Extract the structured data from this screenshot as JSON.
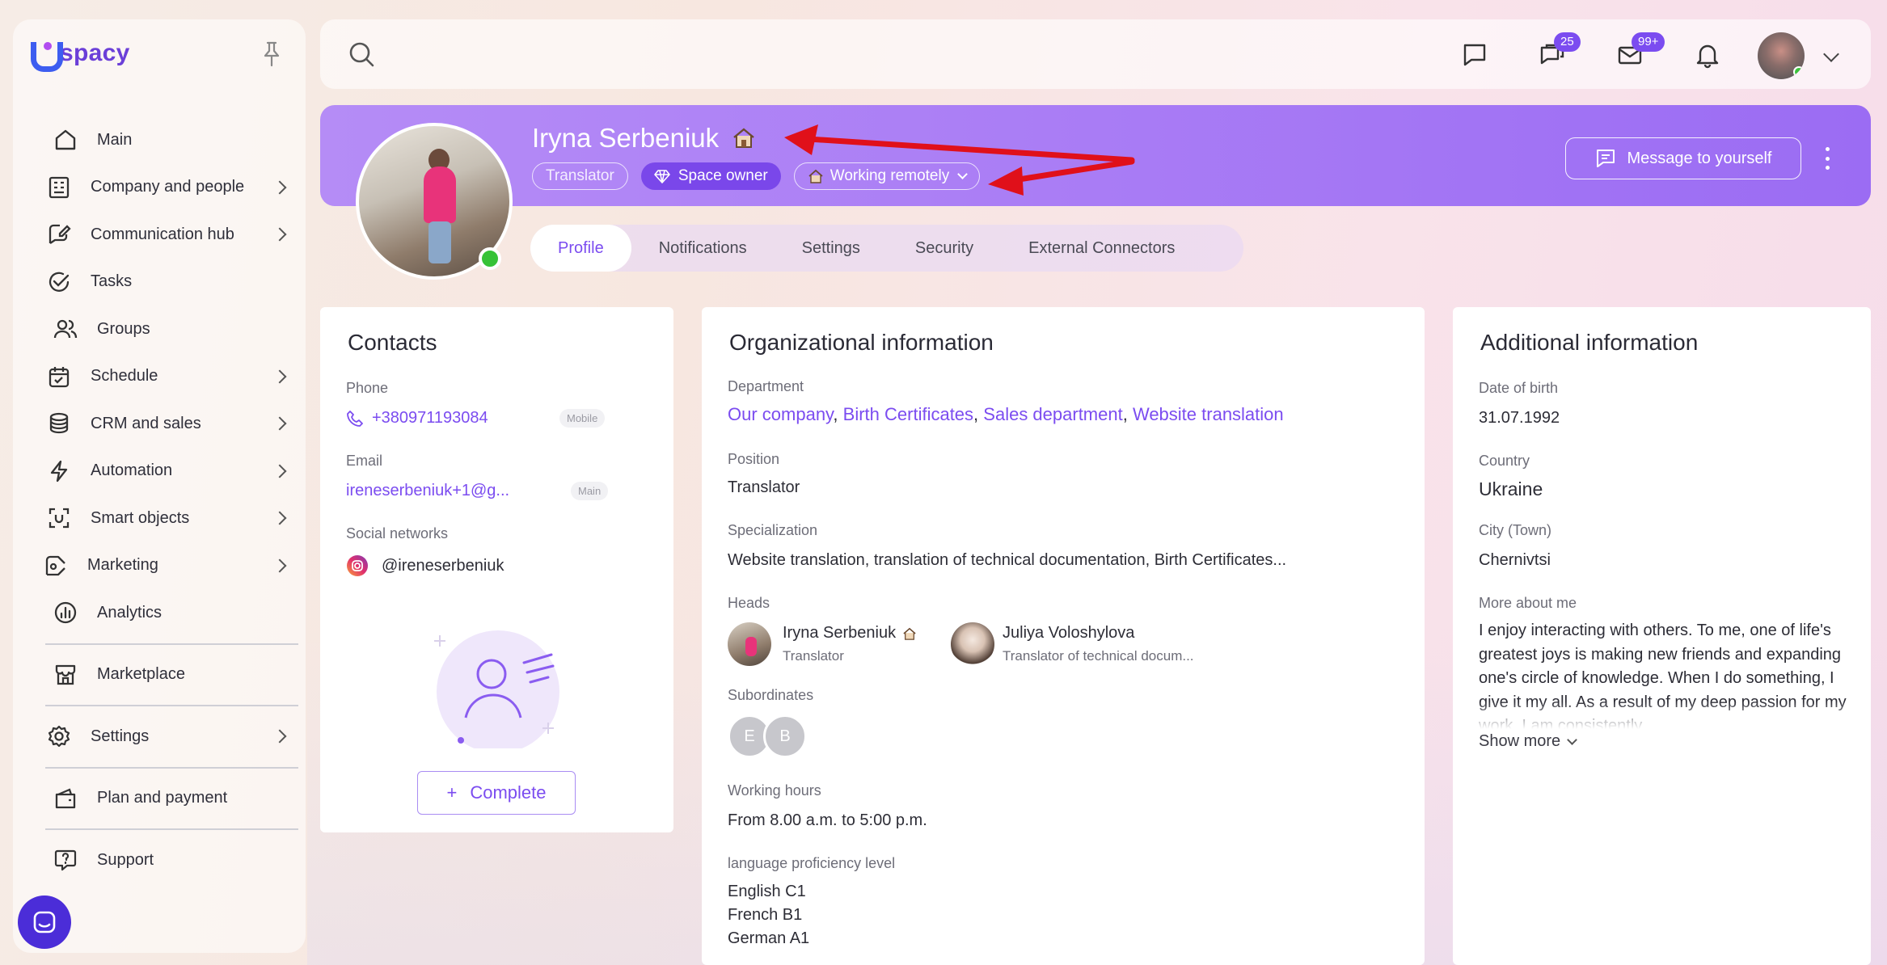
{
  "brand": {
    "name": "spacy"
  },
  "sidebar": {
    "items": [
      {
        "label": "Main",
        "icon": "home-icon",
        "has_arrow": false
      },
      {
        "label": "Company and people",
        "icon": "building-icon",
        "has_arrow": true
      },
      {
        "label": "Communication hub",
        "icon": "chat-edit-icon",
        "has_arrow": true
      },
      {
        "label": "Tasks",
        "icon": "check-circle-icon",
        "has_arrow": false
      },
      {
        "label": "Groups",
        "icon": "users-icon",
        "has_arrow": false
      },
      {
        "label": "Schedule",
        "icon": "calendar-icon",
        "has_arrow": true
      },
      {
        "label": "CRM and sales",
        "icon": "coins-icon",
        "has_arrow": true
      },
      {
        "label": "Automation",
        "icon": "lightning-icon",
        "has_arrow": true
      },
      {
        "label": "Smart objects",
        "icon": "scan-icon",
        "has_arrow": true
      },
      {
        "label": "Marketing",
        "icon": "megaphone-icon",
        "has_arrow": true
      },
      {
        "label": "Analytics",
        "icon": "chart-icon",
        "has_arrow": false
      },
      {
        "label": "Marketplace",
        "icon": "store-icon",
        "has_arrow": false
      },
      {
        "label": "Settings",
        "icon": "gear-icon",
        "has_arrow": true
      },
      {
        "label": "Plan and payment",
        "icon": "wallet-icon",
        "has_arrow": false
      },
      {
        "label": "Support",
        "icon": "help-icon",
        "has_arrow": false
      }
    ]
  },
  "topbar": {
    "chat_badge": "25",
    "mail_badge": "99+"
  },
  "profile": {
    "name": "Iryna Serbeniuk",
    "position_chip": "Translator",
    "owner_chip": "Space owner",
    "status_chip": "Working remotely",
    "message_button": "Message to yourself"
  },
  "tabs": [
    "Profile",
    "Notifications",
    "Settings",
    "Security",
    "External Connectors"
  ],
  "contacts": {
    "title": "Contacts",
    "phone_label": "Phone",
    "phone": "+380971193084",
    "phone_tag": "Mobile",
    "email_label": "Email",
    "email": "ireneserbeniuk+1@g...",
    "email_tag": "Main",
    "social_label": "Social networks",
    "social": "@ireneserbeniuk",
    "complete_button": "Complete"
  },
  "org": {
    "title": "Organizational information",
    "department_label": "Department",
    "departments": [
      "Our company",
      "Birth Certificates",
      "Sales department",
      "Website translation"
    ],
    "position_label": "Position",
    "position": "Translator",
    "spec_label": "Specialization",
    "spec": "Website translation, translation of technical documentation, Birth Certificates...",
    "heads_label": "Heads",
    "heads": [
      {
        "name": "Iryna Serbeniuk",
        "role": "Translator"
      },
      {
        "name": "Juliya Voloshylova",
        "role": "Translator of technical docum..."
      }
    ],
    "subordinates_label": "Subordinates",
    "subordinates": [
      "E",
      "B"
    ],
    "hours_label": "Working hours",
    "hours": "From 8.00 a.m. to 5:00 p.m.",
    "lang_label": "language proficiency level",
    "languages": [
      "English C1",
      "French B1",
      "German A1"
    ]
  },
  "additional": {
    "title": "Additional information",
    "dob_label": "Date of birth",
    "dob": "31.07.1992",
    "country_label": "Country",
    "country": "Ukraine",
    "city_label": "City (Town)",
    "city": "Chernivtsi",
    "more_label": "More about me",
    "more_text": "I enjoy interacting with others. To me, one of life's greatest joys is making new friends and expanding one's circle of knowledge. When I do something, I give it my all. As a result of my deep passion for my work, I am consistently",
    "show_more": "Show more"
  },
  "colors": {
    "accent": "#7b4cf0",
    "header": "#a97cf5",
    "online": "#36c236",
    "arrow": "#e0101a"
  }
}
